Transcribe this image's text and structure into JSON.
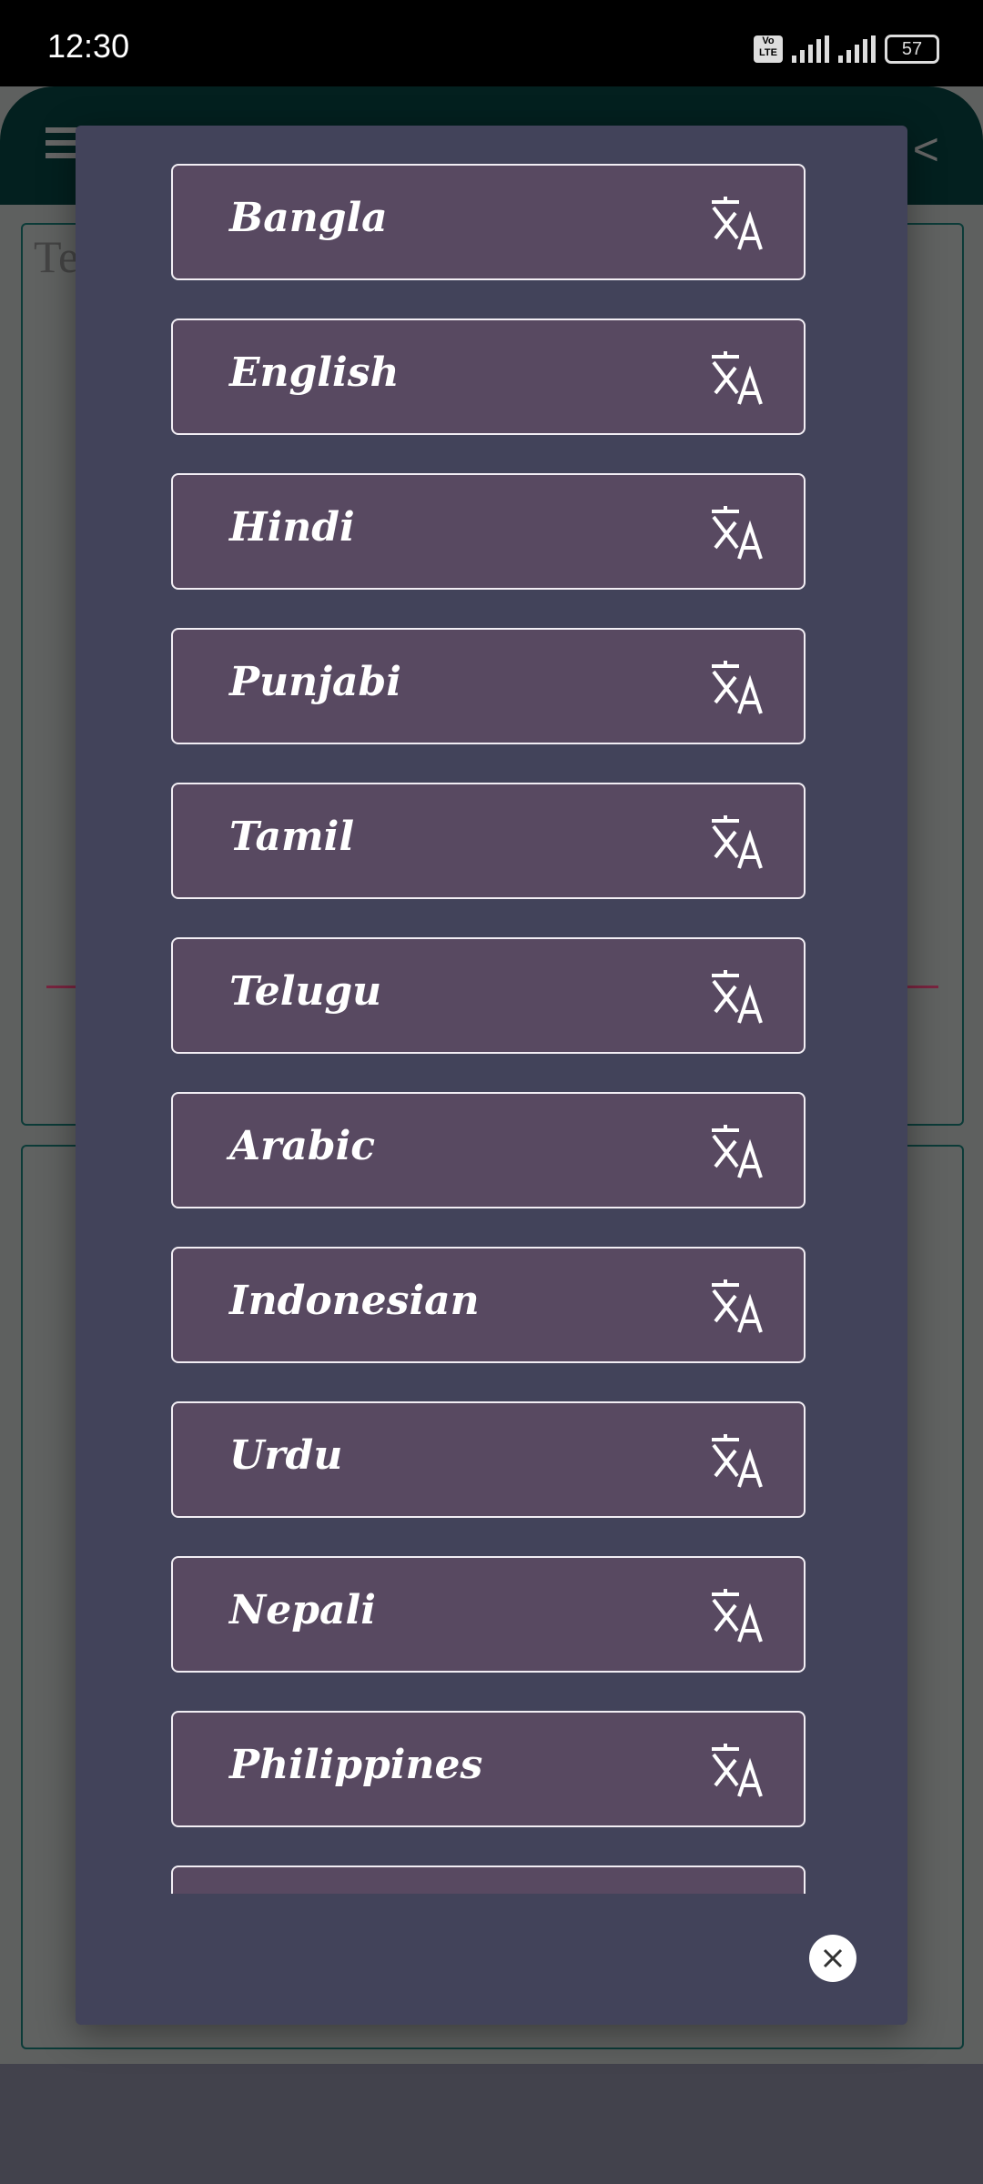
{
  "status_bar": {
    "time": "12:30",
    "battery": "57",
    "network_badge": "Vo LTE"
  },
  "background": {
    "input_placeholder": "Te"
  },
  "dialog": {
    "languages": [
      "Bangla",
      "English",
      "Hindi",
      "Punjabi",
      "Tamil",
      "Telugu",
      "Arabic",
      "Indonesian",
      "Urdu",
      "Nepali",
      "Philippines",
      ""
    ],
    "item_icon": "translate-icon",
    "close_icon": "close-icon"
  }
}
